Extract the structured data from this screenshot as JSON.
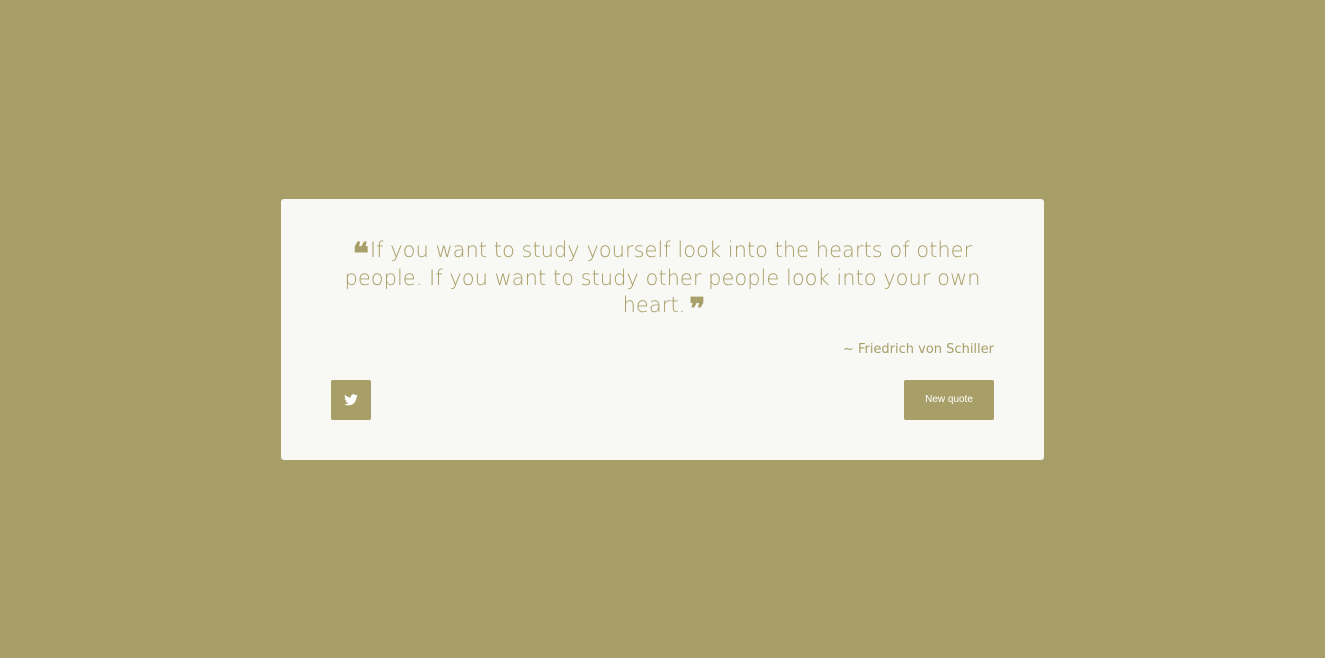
{
  "theme": {
    "accent_color": "#a89f68",
    "card_color": "#f8f8f5",
    "button_text_color": "#ffffff"
  },
  "quote": {
    "open_mark": "❝",
    "text": "If you want to study yourself look into the hearts of other people. If you want to study other people look into your own heart.",
    "close_mark": "❞",
    "author": "~ Friedrich von Schiller"
  },
  "actions": {
    "tweet_icon": "twitter-icon",
    "new_quote_label": "New quote"
  }
}
